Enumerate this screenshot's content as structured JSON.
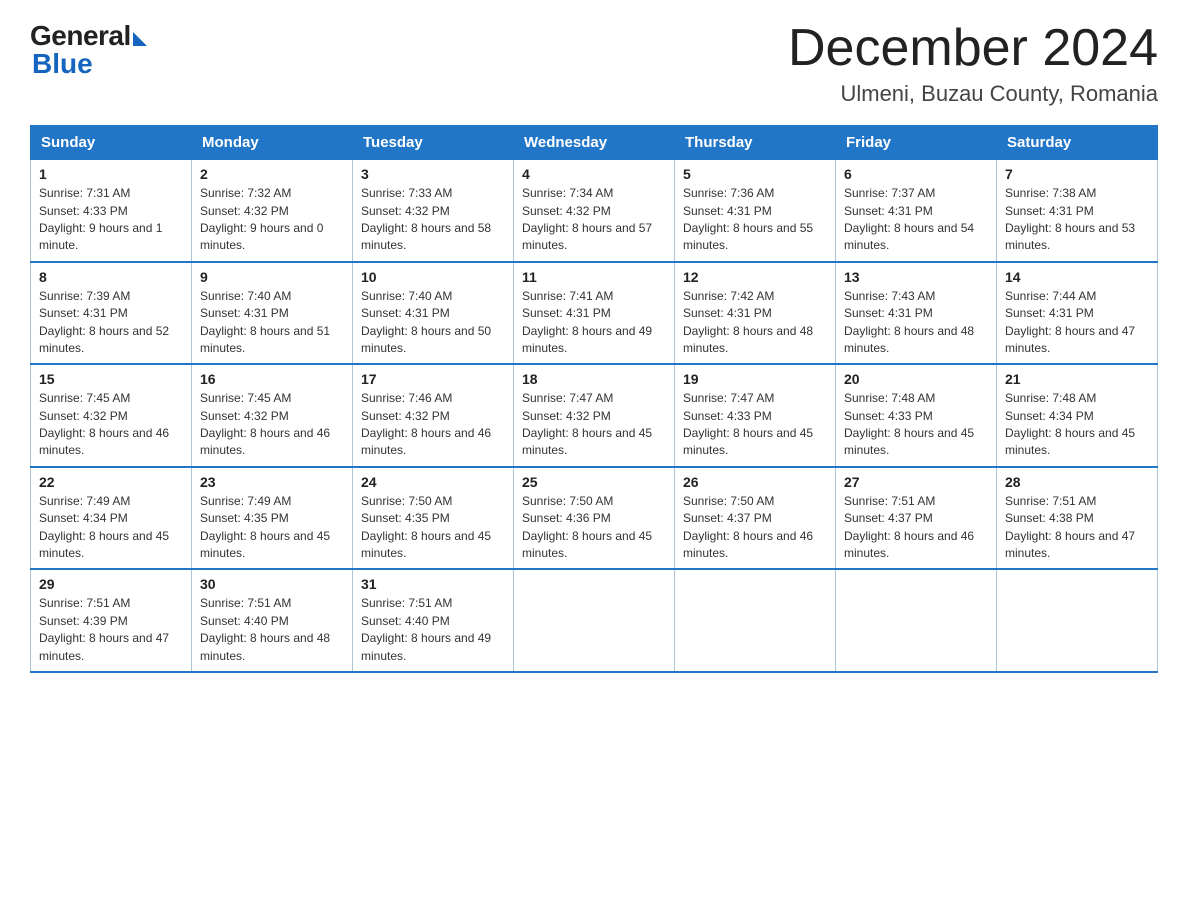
{
  "header": {
    "logo": {
      "general": "General",
      "blue": "Blue"
    },
    "title": "December 2024",
    "location": "Ulmeni, Buzau County, Romania"
  },
  "days_of_week": [
    "Sunday",
    "Monday",
    "Tuesday",
    "Wednesday",
    "Thursday",
    "Friday",
    "Saturday"
  ],
  "weeks": [
    [
      {
        "day": "1",
        "sunrise": "7:31 AM",
        "sunset": "4:33 PM",
        "daylight": "9 hours and 1 minute."
      },
      {
        "day": "2",
        "sunrise": "7:32 AM",
        "sunset": "4:32 PM",
        "daylight": "9 hours and 0 minutes."
      },
      {
        "day": "3",
        "sunrise": "7:33 AM",
        "sunset": "4:32 PM",
        "daylight": "8 hours and 58 minutes."
      },
      {
        "day": "4",
        "sunrise": "7:34 AM",
        "sunset": "4:32 PM",
        "daylight": "8 hours and 57 minutes."
      },
      {
        "day": "5",
        "sunrise": "7:36 AM",
        "sunset": "4:31 PM",
        "daylight": "8 hours and 55 minutes."
      },
      {
        "day": "6",
        "sunrise": "7:37 AM",
        "sunset": "4:31 PM",
        "daylight": "8 hours and 54 minutes."
      },
      {
        "day": "7",
        "sunrise": "7:38 AM",
        "sunset": "4:31 PM",
        "daylight": "8 hours and 53 minutes."
      }
    ],
    [
      {
        "day": "8",
        "sunrise": "7:39 AM",
        "sunset": "4:31 PM",
        "daylight": "8 hours and 52 minutes."
      },
      {
        "day": "9",
        "sunrise": "7:40 AM",
        "sunset": "4:31 PM",
        "daylight": "8 hours and 51 minutes."
      },
      {
        "day": "10",
        "sunrise": "7:40 AM",
        "sunset": "4:31 PM",
        "daylight": "8 hours and 50 minutes."
      },
      {
        "day": "11",
        "sunrise": "7:41 AM",
        "sunset": "4:31 PM",
        "daylight": "8 hours and 49 minutes."
      },
      {
        "day": "12",
        "sunrise": "7:42 AM",
        "sunset": "4:31 PM",
        "daylight": "8 hours and 48 minutes."
      },
      {
        "day": "13",
        "sunrise": "7:43 AM",
        "sunset": "4:31 PM",
        "daylight": "8 hours and 48 minutes."
      },
      {
        "day": "14",
        "sunrise": "7:44 AM",
        "sunset": "4:31 PM",
        "daylight": "8 hours and 47 minutes."
      }
    ],
    [
      {
        "day": "15",
        "sunrise": "7:45 AM",
        "sunset": "4:32 PM",
        "daylight": "8 hours and 46 minutes."
      },
      {
        "day": "16",
        "sunrise": "7:45 AM",
        "sunset": "4:32 PM",
        "daylight": "8 hours and 46 minutes."
      },
      {
        "day": "17",
        "sunrise": "7:46 AM",
        "sunset": "4:32 PM",
        "daylight": "8 hours and 46 minutes."
      },
      {
        "day": "18",
        "sunrise": "7:47 AM",
        "sunset": "4:32 PM",
        "daylight": "8 hours and 45 minutes."
      },
      {
        "day": "19",
        "sunrise": "7:47 AM",
        "sunset": "4:33 PM",
        "daylight": "8 hours and 45 minutes."
      },
      {
        "day": "20",
        "sunrise": "7:48 AM",
        "sunset": "4:33 PM",
        "daylight": "8 hours and 45 minutes."
      },
      {
        "day": "21",
        "sunrise": "7:48 AM",
        "sunset": "4:34 PM",
        "daylight": "8 hours and 45 minutes."
      }
    ],
    [
      {
        "day": "22",
        "sunrise": "7:49 AM",
        "sunset": "4:34 PM",
        "daylight": "8 hours and 45 minutes."
      },
      {
        "day": "23",
        "sunrise": "7:49 AM",
        "sunset": "4:35 PM",
        "daylight": "8 hours and 45 minutes."
      },
      {
        "day": "24",
        "sunrise": "7:50 AM",
        "sunset": "4:35 PM",
        "daylight": "8 hours and 45 minutes."
      },
      {
        "day": "25",
        "sunrise": "7:50 AM",
        "sunset": "4:36 PM",
        "daylight": "8 hours and 45 minutes."
      },
      {
        "day": "26",
        "sunrise": "7:50 AM",
        "sunset": "4:37 PM",
        "daylight": "8 hours and 46 minutes."
      },
      {
        "day": "27",
        "sunrise": "7:51 AM",
        "sunset": "4:37 PM",
        "daylight": "8 hours and 46 minutes."
      },
      {
        "day": "28",
        "sunrise": "7:51 AM",
        "sunset": "4:38 PM",
        "daylight": "8 hours and 47 minutes."
      }
    ],
    [
      {
        "day": "29",
        "sunrise": "7:51 AM",
        "sunset": "4:39 PM",
        "daylight": "8 hours and 47 minutes."
      },
      {
        "day": "30",
        "sunrise": "7:51 AM",
        "sunset": "4:40 PM",
        "daylight": "8 hours and 48 minutes."
      },
      {
        "day": "31",
        "sunrise": "7:51 AM",
        "sunset": "4:40 PM",
        "daylight": "8 hours and 49 minutes."
      },
      null,
      null,
      null,
      null
    ]
  ]
}
